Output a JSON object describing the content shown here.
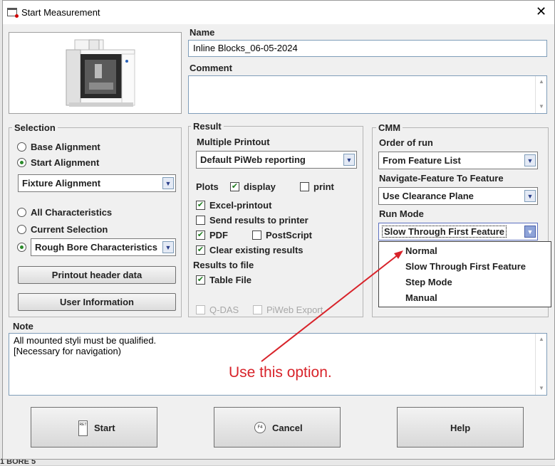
{
  "window": {
    "title": "Start Measurement"
  },
  "name": {
    "label": "Name",
    "value": "Inline Blocks_06-05-2024"
  },
  "comment": {
    "label": "Comment",
    "value": ""
  },
  "selection": {
    "title": "Selection",
    "base_alignment": "Base Alignment",
    "start_alignment": "Start Alignment",
    "alignment_combo": "Fixture Alignment",
    "all_characteristics": "All Characteristics",
    "current_selection": "Current Selection",
    "characteristics_combo": "Rough Bore Characteristics",
    "printout_header_btn": "Printout header data",
    "user_info_btn": "User Information"
  },
  "result": {
    "title": "Result",
    "multiple_printout_label": "Multiple Printout",
    "printout_combo": "Default PiWeb reporting",
    "plots_label": "Plots",
    "display": "display",
    "print": "print",
    "excel_printout": "Excel-printout",
    "send_results": "Send results to printer",
    "pdf": "PDF",
    "postscript": "PostScript",
    "clear_results": "Clear existing results",
    "results_to_file_label": "Results to file",
    "table_file": "Table File",
    "qdas": "Q-DAS",
    "piweb_export": "PiWeb Export"
  },
  "cmm": {
    "title": "CMM",
    "order_label": "Order of run",
    "order_combo": "From Feature List",
    "navigate_label": "Navigate-Feature To Feature",
    "navigate_combo": "Use Clearance Plane",
    "run_mode_label": "Run Mode",
    "run_mode_combo": "Slow Through First Feature",
    "run_mode_options": [
      "Normal",
      "Slow Through First Feature",
      "Step Mode",
      "Manual"
    ]
  },
  "note": {
    "label": "Note",
    "line1": "All mounted styli must be qualified.",
    "line2": "[Necessary for navigation)"
  },
  "buttons": {
    "start": "Start",
    "start_key": "RET",
    "cancel": "Cancel",
    "cancel_key": "F4",
    "help": "Help"
  },
  "annotation": {
    "text": "Use this option.",
    "color": "#d8232a"
  },
  "background": {
    "bottom_fragment": "1 BORE 5"
  }
}
